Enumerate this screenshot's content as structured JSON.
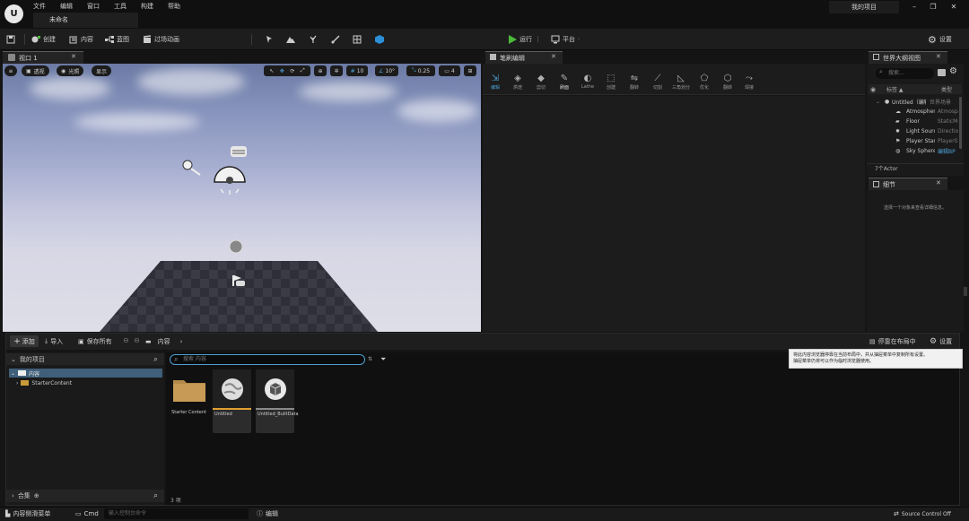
{
  "app": {
    "project_name": "我的项目",
    "document_tab": "未命名"
  },
  "menu": [
    "文件",
    "编辑",
    "窗口",
    "工具",
    "构建",
    "帮助"
  ],
  "toolbar": {
    "create": "创建",
    "content": "内容",
    "blueprint": "蓝图",
    "cinematics": "过场动画",
    "play": "运行",
    "platform": "平台",
    "settings": "设置"
  },
  "viewport": {
    "tab": "视口 1",
    "perspective": "透视",
    "lit": "光照",
    "show": "显示",
    "grid_size": "10",
    "rotation_snap": "10°",
    "scale_snap": "0.25",
    "camera_speed": "4"
  },
  "brush_editor": {
    "tab": "笔刷编辑",
    "tools": [
      "编辑",
      "烘焙",
      "剪切",
      "刷面",
      "Lathe",
      "创建",
      "翻转",
      "切割",
      "三角划分",
      "优化",
      "翻转",
      "焊接"
    ]
  },
  "outliner": {
    "tab": "世界大纲视图",
    "search_placeholder": "搜索...",
    "col_label": "标签 ▲",
    "col_type": "类型",
    "items": [
      {
        "name": "Untitled（编辑器）",
        "type": "世界场景"
      },
      {
        "name": "Atmospheric Fog",
        "type": "AtmosphericFog"
      },
      {
        "name": "Floor",
        "type": "StaticMeshActor"
      },
      {
        "name": "Light Source",
        "type": "DirectionalLight"
      },
      {
        "name": "Player Start",
        "type": "PlayerStart"
      },
      {
        "name": "Sky Sphere",
        "type": "编辑BP"
      }
    ],
    "count": "7个Actor"
  },
  "details": {
    "tab": "细节",
    "empty_message": "选择一个对象来查看详细信息。"
  },
  "content_browser": {
    "add": "添加",
    "import": "导入",
    "save_all": "保存所有",
    "path": "内容",
    "dock_layout": "停靠在布局中",
    "settings": "设置",
    "my_project": "我的项目",
    "tree": [
      "内容",
      "StarterContent"
    ],
    "collections": "合集",
    "search_placeholder": "搜索 内容",
    "assets": [
      {
        "name": "Starter Content"
      },
      {
        "name": "Untitled"
      },
      {
        "name": "Untitled_BuiltData"
      }
    ],
    "item_count": "3 项"
  },
  "tooltip": {
    "line1": "将此内容浏览器停靠在当前布局中，并从抽屉菜单中复制所有设置。",
    "line2": "抽屉菜单仍将可以作为临时浏览器使用。"
  },
  "statusbar": {
    "content_drawer": "内容侧滑菜单",
    "cmd": "Cmd",
    "cmd_placeholder": "输入控制台命令",
    "derived_data": "编辑",
    "source_control": "Source Control Off"
  },
  "colors": {
    "accent_blue": "#4ea0d4",
    "play_green": "#4cba3a",
    "selection": "#3f5f7a",
    "asset_orange": "#e0a030"
  }
}
